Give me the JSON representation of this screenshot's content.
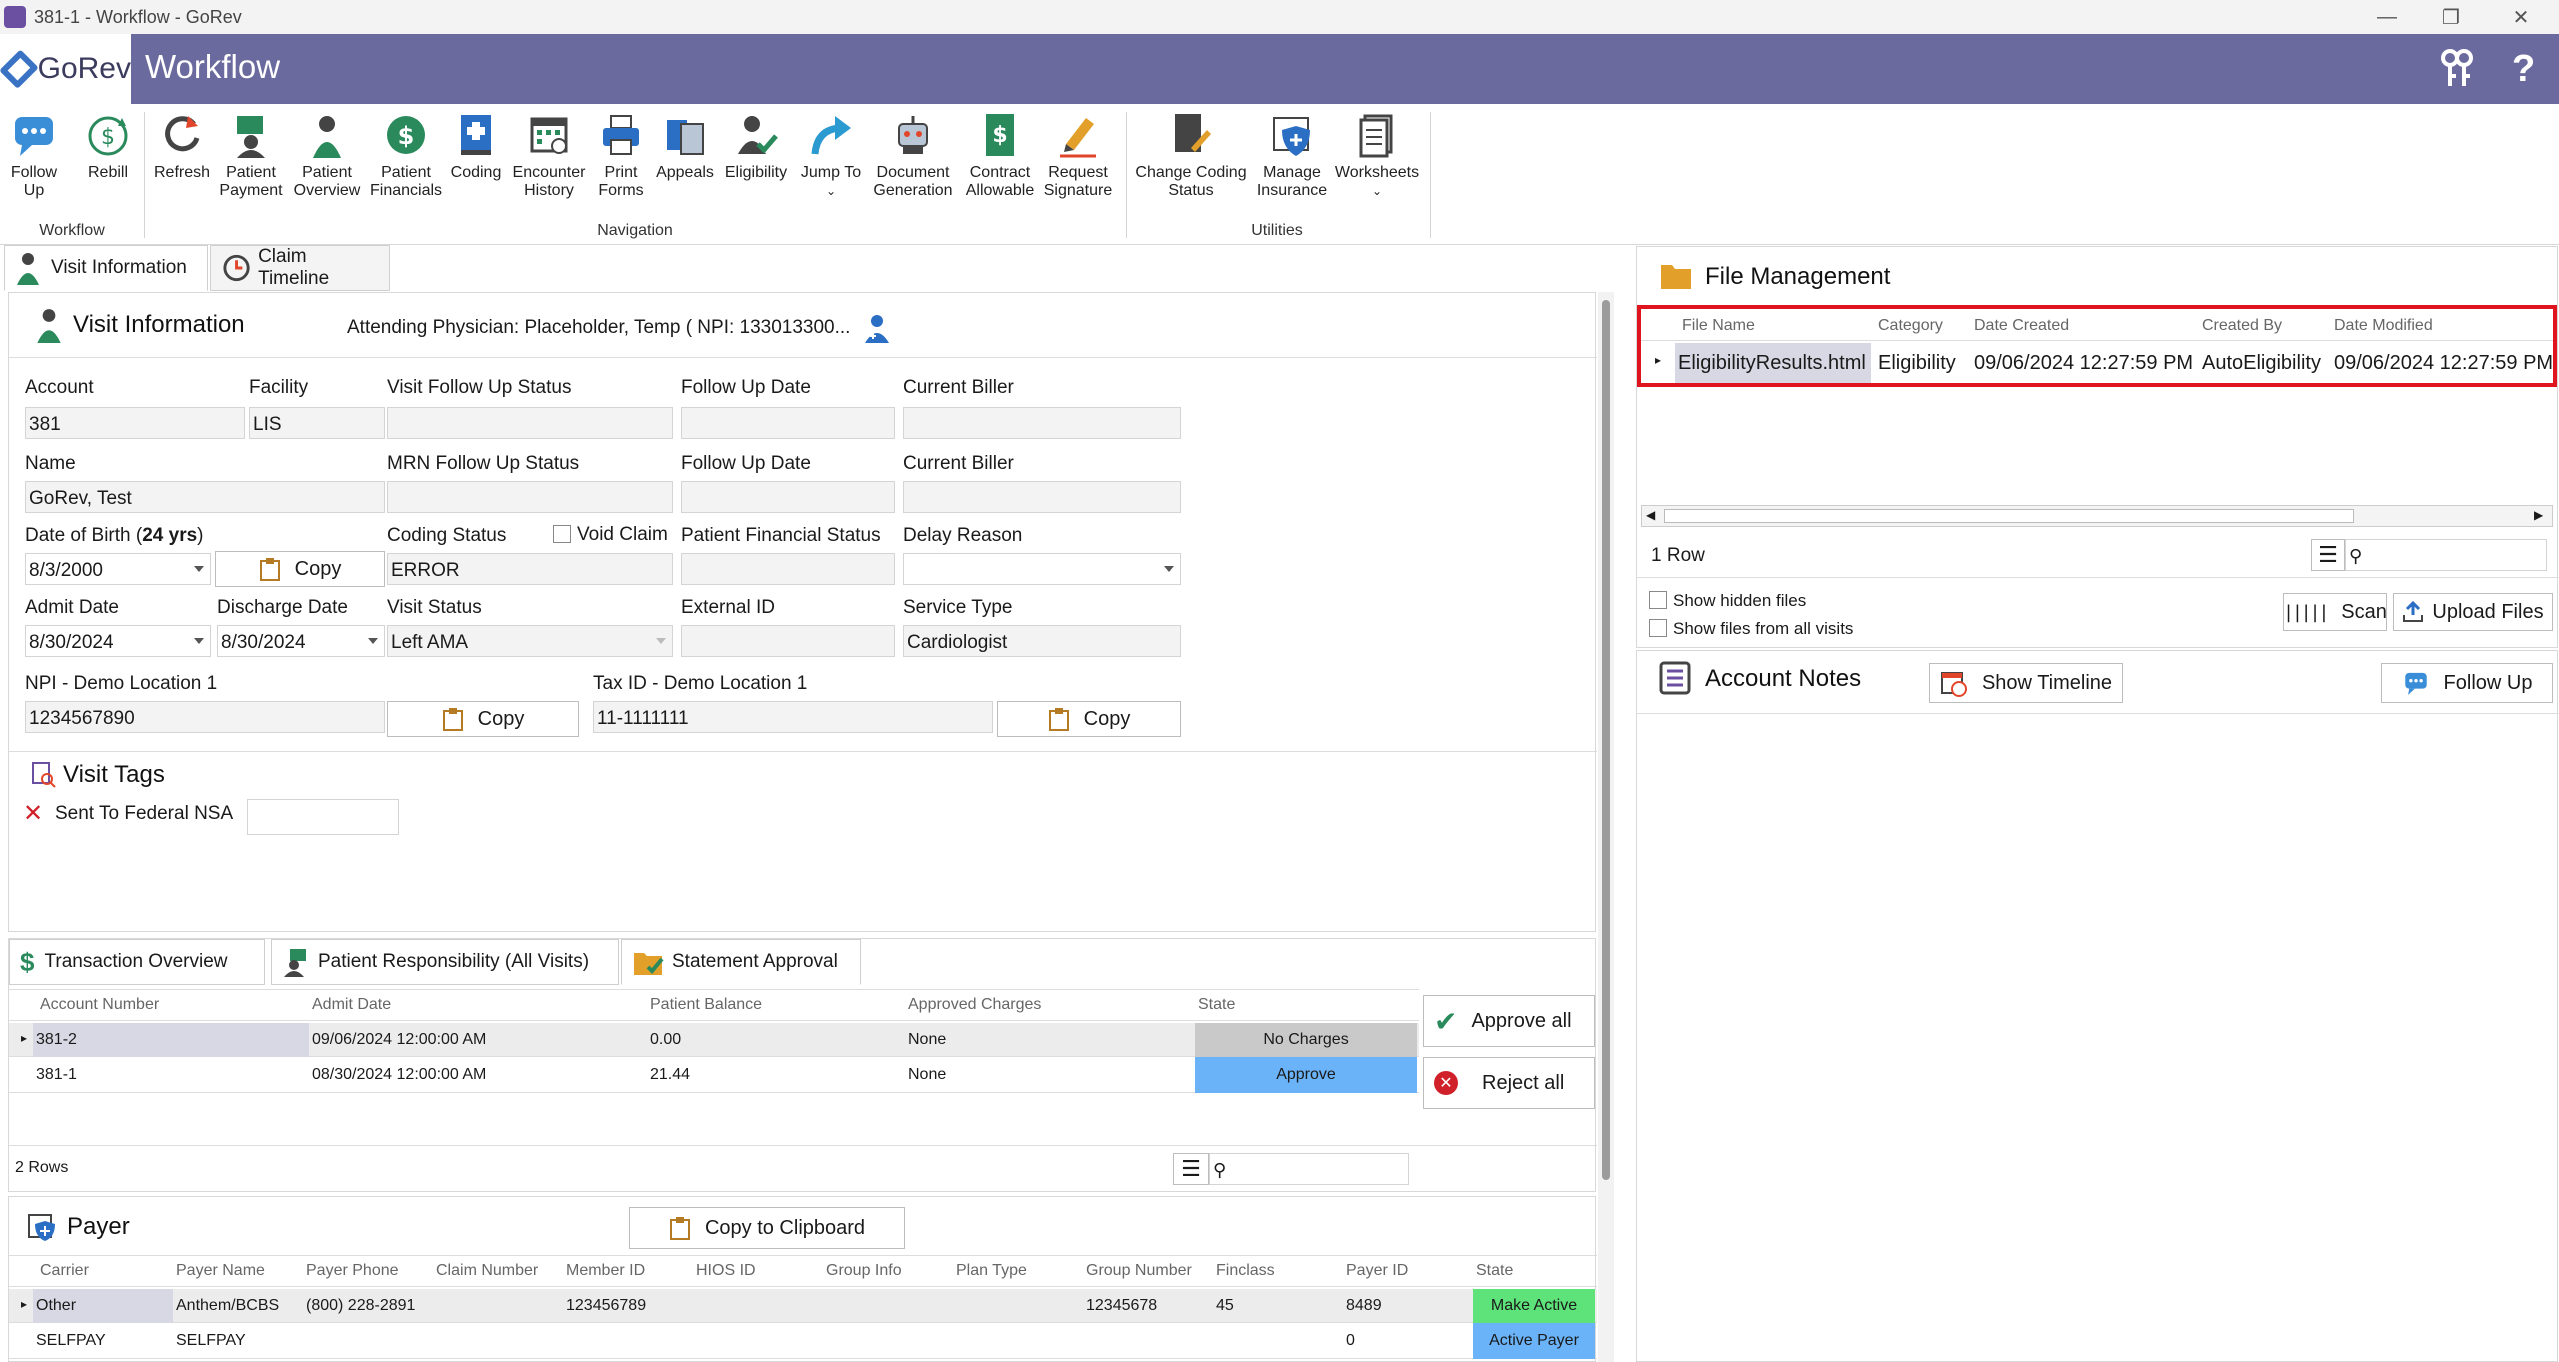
{
  "window": {
    "title": "381-1 - Workflow - GoRev",
    "min": "—",
    "restore": "❐",
    "close": "✕"
  },
  "header": {
    "logo": "GoRev",
    "title": "Workflow",
    "user_icon": "⌂",
    "help": "?"
  },
  "ribbon": {
    "follow_up": "Follow\nUp",
    "rebill": "Rebill",
    "refresh": "Refresh",
    "patient_payment": "Patient\nPayment",
    "patient_overview": "Patient\nOverview",
    "patient_financials": "Patient\nFinancials",
    "coding": "Coding",
    "encounter_history": "Encounter\nHistory",
    "print_forms": "Print\nForms",
    "appeals": "Appeals",
    "eligibility": "Eligibility",
    "jump_to": "Jump To",
    "document_generation": "Document\nGeneration",
    "contract_allowable": "Contract\nAllowable",
    "request_signature": "Request\nSignature",
    "change_coding_status": "Change Coding\nStatus",
    "manage_insurance": "Manage\nInsurance",
    "worksheets": "Worksheets",
    "group_workflow": "Workflow",
    "group_navigation": "Navigation",
    "group_utilities": "Utilities"
  },
  "tabs": {
    "visit_info": "Visit Information",
    "claim_timeline": "Claim Timeline"
  },
  "visit": {
    "title": "Visit Information",
    "attending": "Attending Physician: Placeholder, Temp ( NPI: 133013300...",
    "account_label": "Account",
    "account": "381",
    "facility_label": "Facility",
    "facility": "LIS",
    "visit_follow_up_status_label": "Visit Follow Up Status",
    "follow_up_date_label": "Follow Up Date",
    "current_biller_label": "Current Biller",
    "name_label": "Name",
    "name": "GoRev, Test",
    "mrn_follow_up_status_label": "MRN Follow Up Status",
    "dob_label": "Date of Birth (",
    "dob_age": "24 yrs",
    "dob_close": ")",
    "dob": "8/3/2000",
    "copy": "Copy",
    "coding_status_label": "Coding Status",
    "void_claim": "Void Claim",
    "coding_status": "ERROR",
    "patient_financial_status_label": "Patient Financial Status",
    "delay_reason_label": "Delay Reason",
    "admit_date_label": "Admit Date",
    "admit_date": "8/30/2024",
    "discharge_date_label": "Discharge Date",
    "discharge_date": "8/30/2024",
    "visit_status_label": "Visit Status",
    "visit_status": "Left AMA",
    "external_id_label": "External ID",
    "service_type_label": "Service Type",
    "service_type": "Cardiologist",
    "npi_label": "NPI - Demo Location 1",
    "npi": "1234567890",
    "tax_id_label": "Tax ID - Demo Location 1",
    "tax_id": "11-1111111"
  },
  "tags": {
    "title": "Visit Tags",
    "tag": "Sent To Federal NSA"
  },
  "bottom_tabs": {
    "transaction": "Transaction Overview",
    "responsibility": "Patient Responsibility (All Visits)",
    "statement": "Statement Approval"
  },
  "statement": {
    "headers": [
      "Account Number",
      "Admit Date",
      "Patient Balance",
      "Approved Charges",
      "State"
    ],
    "rows": [
      [
        "381-2",
        "09/06/2024 12:00:00 AM",
        "0.00",
        "None",
        "No Charges"
      ],
      [
        "381-1",
        "08/30/2024 12:00:00 AM",
        "21.44",
        "None",
        "Approve"
      ]
    ],
    "count": "2 Rows",
    "approve_all": "Approve all",
    "reject_all": "Reject all",
    "colors": {
      "no_charges": "#c9c9c9",
      "approve": "#6ab3f8"
    }
  },
  "payer": {
    "title": "Payer",
    "copy": "Copy to Clipboard",
    "headers": [
      "Carrier",
      "Payer Name",
      "Payer Phone",
      "Claim Number",
      "Member ID",
      "HIOS ID",
      "Group Info",
      "Plan Type",
      "Group Number",
      "Finclass",
      "Payer ID",
      "State"
    ],
    "rows": [
      [
        "Other",
        "Anthem/BCBS",
        "(800) 228-2891",
        "",
        "123456789",
        "",
        "",
        "",
        "12345678",
        "45",
        "8489",
        "Make Active"
      ],
      [
        "SELFPAY",
        "SELFPAY",
        "",
        "",
        "",
        "",
        "",
        "",
        "",
        "",
        "0",
        "Active Payer"
      ]
    ],
    "colors": {
      "make_active": "#5de37a",
      "active_payer": "#6ab3f8"
    }
  },
  "files": {
    "title": "File Management",
    "headers": [
      "File Name",
      "Category",
      "Date Created",
      "Created By",
      "Date Modified"
    ],
    "row": [
      "EligibilityResults.html",
      "Eligibility",
      "09/06/2024 12:27:59 PM",
      "AutoEligibility",
      "09/06/2024 12:27:59 PM"
    ],
    "count": "1 Row",
    "show_hidden": "Show hidden files",
    "show_all_visits": "Show files from all visits",
    "scan": "Scan",
    "upload": "Upload Files",
    "highlight": "#e0141e"
  },
  "notes": {
    "title": "Account Notes",
    "show_timeline": "Show Timeline",
    "follow_up": "Follow Up"
  }
}
